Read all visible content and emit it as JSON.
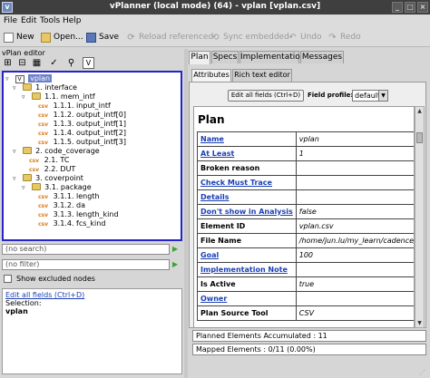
{
  "window": {
    "title": "vPlanner (local mode) (64) - vplan [vplan.csv]",
    "app_icon": "vplanner-app-icon",
    "controls": [
      "_",
      "□",
      "×"
    ]
  },
  "menu": [
    "File",
    "Edit",
    "Tools",
    "Help"
  ],
  "toolbar": {
    "new": "New",
    "open": "Open...",
    "save": "Save",
    "reload": "Reload referenced",
    "sync": "Sync embedded",
    "undo": "Undo",
    "redo": "Redo"
  },
  "editor": {
    "label": "vPlan editor",
    "tools": [
      "⊞",
      "⊟",
      "▦",
      "✓",
      "⚲",
      "V"
    ],
    "tree": [
      {
        "label": "vplan",
        "type": "root",
        "toggle": "▿",
        "selected": true
      },
      {
        "label": "1. interface",
        "type": "folder",
        "toggle": "▿"
      },
      {
        "label": "1.1. mem_intf",
        "type": "folder",
        "toggle": "▿"
      },
      {
        "label": "1.1.1. input_intf",
        "type": "csv"
      },
      {
        "label": "1.1.2. output_intf[0]",
        "type": "csv"
      },
      {
        "label": "1.1.3. output_intf[1]",
        "type": "csv"
      },
      {
        "label": "1.1.4. output_intf[2]",
        "type": "csv"
      },
      {
        "label": "1.1.5. output_intf[3]",
        "type": "csv"
      },
      {
        "label": "2. code_coverage",
        "type": "folder",
        "toggle": "▿"
      },
      {
        "label": "2.1. TC",
        "type": "csv"
      },
      {
        "label": "2.2. DUT",
        "type": "csv"
      },
      {
        "label": "3. coverpoint",
        "type": "folder",
        "toggle": "▿"
      },
      {
        "label": "3.1. package",
        "type": "folder",
        "toggle": "▿"
      },
      {
        "label": "3.1.1. length",
        "type": "csv"
      },
      {
        "label": "3.1.2. da",
        "type": "csv"
      },
      {
        "label": "3.1.3. length_kind",
        "type": "csv"
      },
      {
        "label": "3.1.4. fcs_kind",
        "type": "csv"
      }
    ],
    "csv_tag": "csv",
    "search": "(no search)",
    "filter": "(no filter)",
    "show_excluded": "Show excluded nodes",
    "edit_all_link": "Edit all fields (Ctrl+D)",
    "selection_label": "Selection:",
    "selection_value": "vplan"
  },
  "tabs": [
    "Plan",
    "Specs",
    "Implementation",
    "Messages"
  ],
  "subtabs": [
    "Attributes",
    "Rich text editor"
  ],
  "attributes": {
    "edit_all_button": "Edit all fields (Ctrl+D)",
    "profile_label": "Field profile:",
    "profile_value": "default",
    "sheet_title": "Plan",
    "rows": [
      {
        "key": "Name",
        "value": "vplan",
        "link": true
      },
      {
        "key": "At Least",
        "value": "1",
        "link": true
      },
      {
        "key": "Broken reason",
        "value": "",
        "link": false
      },
      {
        "key": "Check Must Trace",
        "value": "",
        "link": true
      },
      {
        "key": "Details",
        "value": "",
        "link": true
      },
      {
        "key": "Don't show in Analysis",
        "value": "false",
        "link": true
      },
      {
        "key": "Element ID",
        "value": "vplan.csv",
        "link": false
      },
      {
        "key": "File Name",
        "value": "/home/jun.lu/my_learn/cadence/vm",
        "link": false
      },
      {
        "key": "Goal",
        "value": "100",
        "link": true
      },
      {
        "key": "Implementation Note",
        "value": "",
        "link": true
      },
      {
        "key": "Is Active",
        "value": "true",
        "link": false
      },
      {
        "key": "Owner",
        "value": "",
        "link": true
      },
      {
        "key": "Plan Source Tool",
        "value": "CSV",
        "link": false
      }
    ]
  },
  "status": {
    "planned": "Planned Elements Accumulated : 11",
    "mapped": "Mapped Elements : 0/11 (0.00%)"
  },
  "colors": {
    "tree_border": "#2424c8",
    "selection": "#6b7fc8",
    "link": "#1a3fb3",
    "titlebar": "#3f3f3f"
  }
}
